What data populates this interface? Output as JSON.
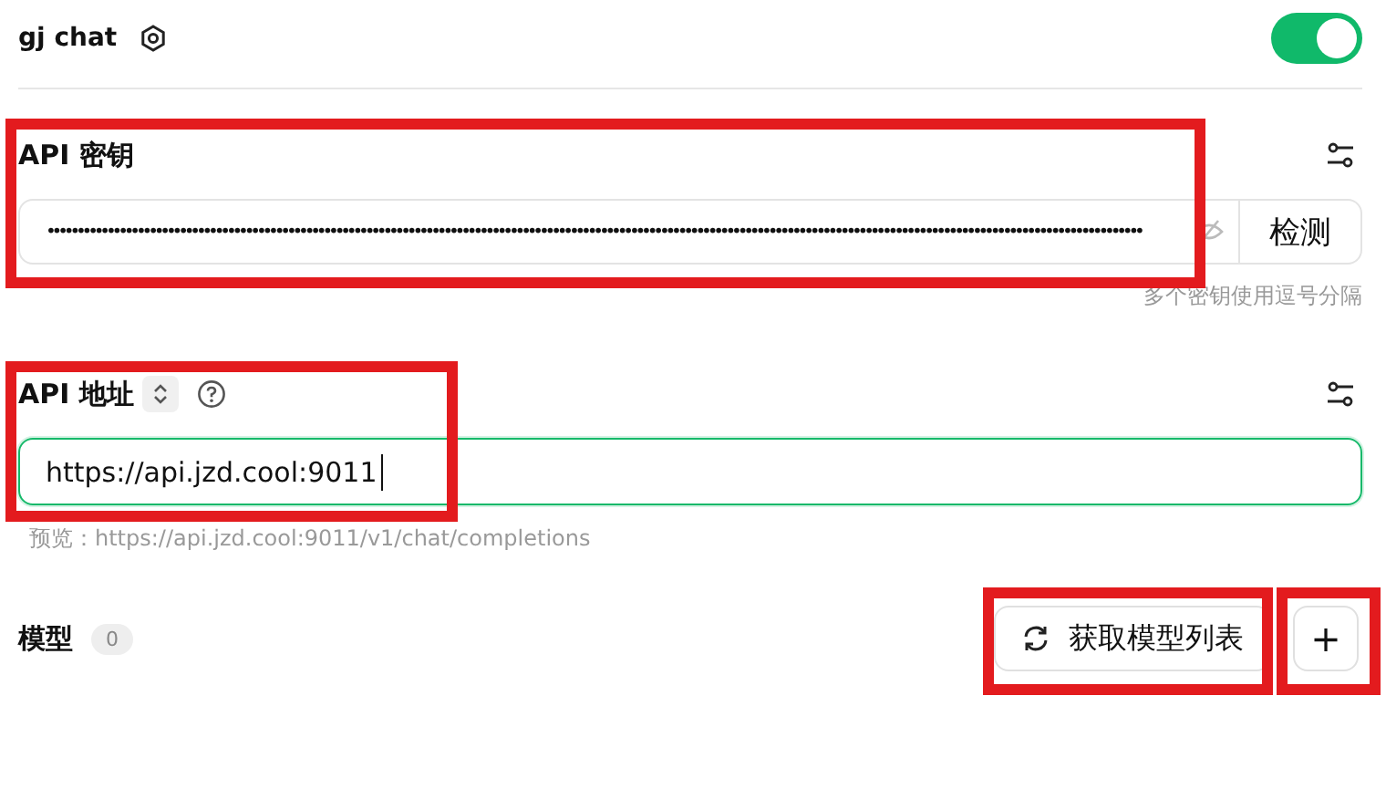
{
  "provider": {
    "name": "gj chat",
    "enabled": true
  },
  "api_key": {
    "label": "API 密钥",
    "value": "••••••••••••••••••••••••••••••••••••••••••••••••••••••••••••••••••••••••••••••••••••••••••••••••••••••••••••••••••••••••••••••••••••••••••••••••••••••••••••••••••••••••••••••••••••••",
    "check_button": "检测",
    "hint": "多个密钥使用逗号分隔"
  },
  "api_host": {
    "label": "API 地址",
    "value": "https://api.jzd.cool:9011",
    "preview": "预览：https://api.jzd.cool:9011/v1/chat/completions"
  },
  "models": {
    "label": "模型",
    "count": "0",
    "fetch_button": "获取模型列表",
    "add_button": "+"
  }
}
